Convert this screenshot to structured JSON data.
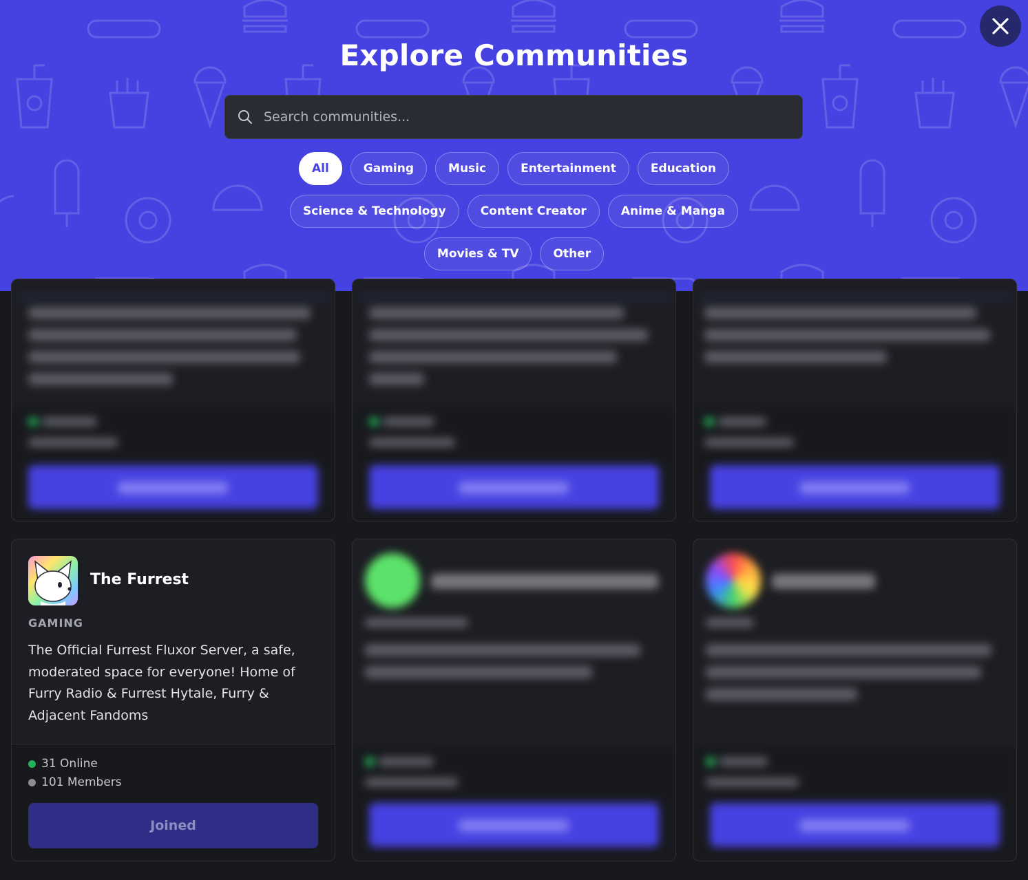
{
  "header": {
    "title": "Explore Communities",
    "close_label": "×"
  },
  "search": {
    "placeholder": "Search communities..."
  },
  "categories": [
    {
      "label": "All",
      "active": true
    },
    {
      "label": "Gaming"
    },
    {
      "label": "Music"
    },
    {
      "label": "Entertainment"
    },
    {
      "label": "Education"
    },
    {
      "label": "Science & Technology"
    },
    {
      "label": "Content Creator"
    },
    {
      "label": "Anime & Manga"
    },
    {
      "label": "Movies & TV"
    },
    {
      "label": "Other"
    }
  ],
  "featured_card": {
    "name": "The Furrest",
    "category": "GAMING",
    "description": "The Official Furrest Fluxor Server, a safe, moderated space for everyone! Home of Furry Radio & Furrest Hytale, Furry & Adjacent Fandoms",
    "online": "31 Online",
    "members": "101 Members",
    "button_label": "Joined"
  },
  "colors": {
    "accent": "#4641e1",
    "background": "#18191d",
    "online_dot": "#22b35a",
    "members_dot": "#8b8c96"
  }
}
